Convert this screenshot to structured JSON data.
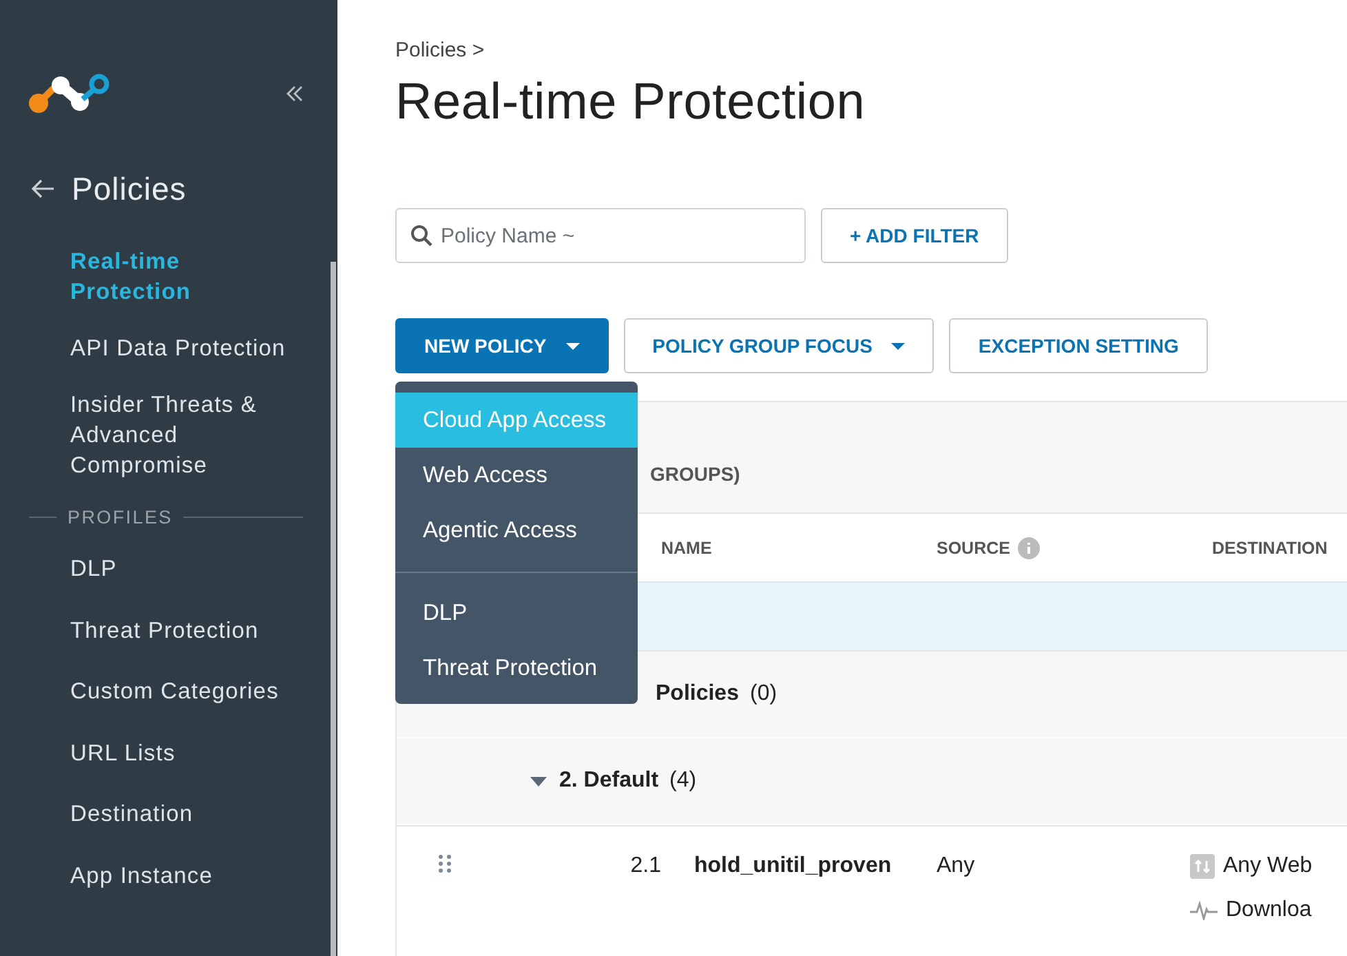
{
  "sidebar": {
    "title": "Policies",
    "items": [
      {
        "label": "Real-time Protection",
        "selected": true
      },
      {
        "label": "API Data Protection",
        "selected": false
      },
      {
        "label": "Insider Threats & Advanced Compromise",
        "selected": false
      }
    ],
    "section": "PROFILES",
    "profile_items": [
      {
        "label": "DLP",
        "selected": false
      },
      {
        "label": "Threat Protection",
        "selected": false
      },
      {
        "label": "Custom Categories",
        "selected": false
      },
      {
        "label": "URL Lists",
        "selected": false
      },
      {
        "label": "Destination",
        "selected": false
      },
      {
        "label": "App Instance",
        "selected": false
      }
    ]
  },
  "breadcrumb": "Policies >",
  "page_title": "Real-time Protection",
  "search": {
    "placeholder": "Policy Name ~"
  },
  "add_filter": "+ ADD FILTER",
  "buttons": [
    {
      "label": "NEW POLICY",
      "kind": "primary"
    },
    {
      "label": "POLICY GROUP FOCUS",
      "kind": "dropdown"
    },
    {
      "label": "EXCEPTION SETTING",
      "kind": "plain"
    }
  ],
  "menu": {
    "groups": [
      [
        {
          "label": "Cloud App Access",
          "selected": true
        },
        {
          "label": "Web Access",
          "selected": false
        },
        {
          "label": "Agentic Access",
          "selected": false
        }
      ],
      [
        {
          "label": "DLP",
          "selected": false
        },
        {
          "label": "Threat Protection",
          "selected": false
        }
      ]
    ]
  },
  "table": {
    "summary": "GROUPS)",
    "columns": [
      {
        "label": "NAME",
        "info": false
      },
      {
        "label": "SOURCE",
        "info": true
      },
      {
        "label": "DESTINATION",
        "info": false
      }
    ],
    "groups": [
      {
        "name": "Policies",
        "count": "(0)"
      },
      {
        "name": "2. Default",
        "count": "(4)",
        "expanded": true
      }
    ],
    "rows": [
      {
        "number": "2.1",
        "name": "hold_unitil_proven",
        "source": "Any",
        "destination": [
          {
            "kind": "web",
            "text": "Any Web"
          },
          {
            "kind": "activity",
            "text": "Downloa"
          }
        ]
      }
    ]
  }
}
